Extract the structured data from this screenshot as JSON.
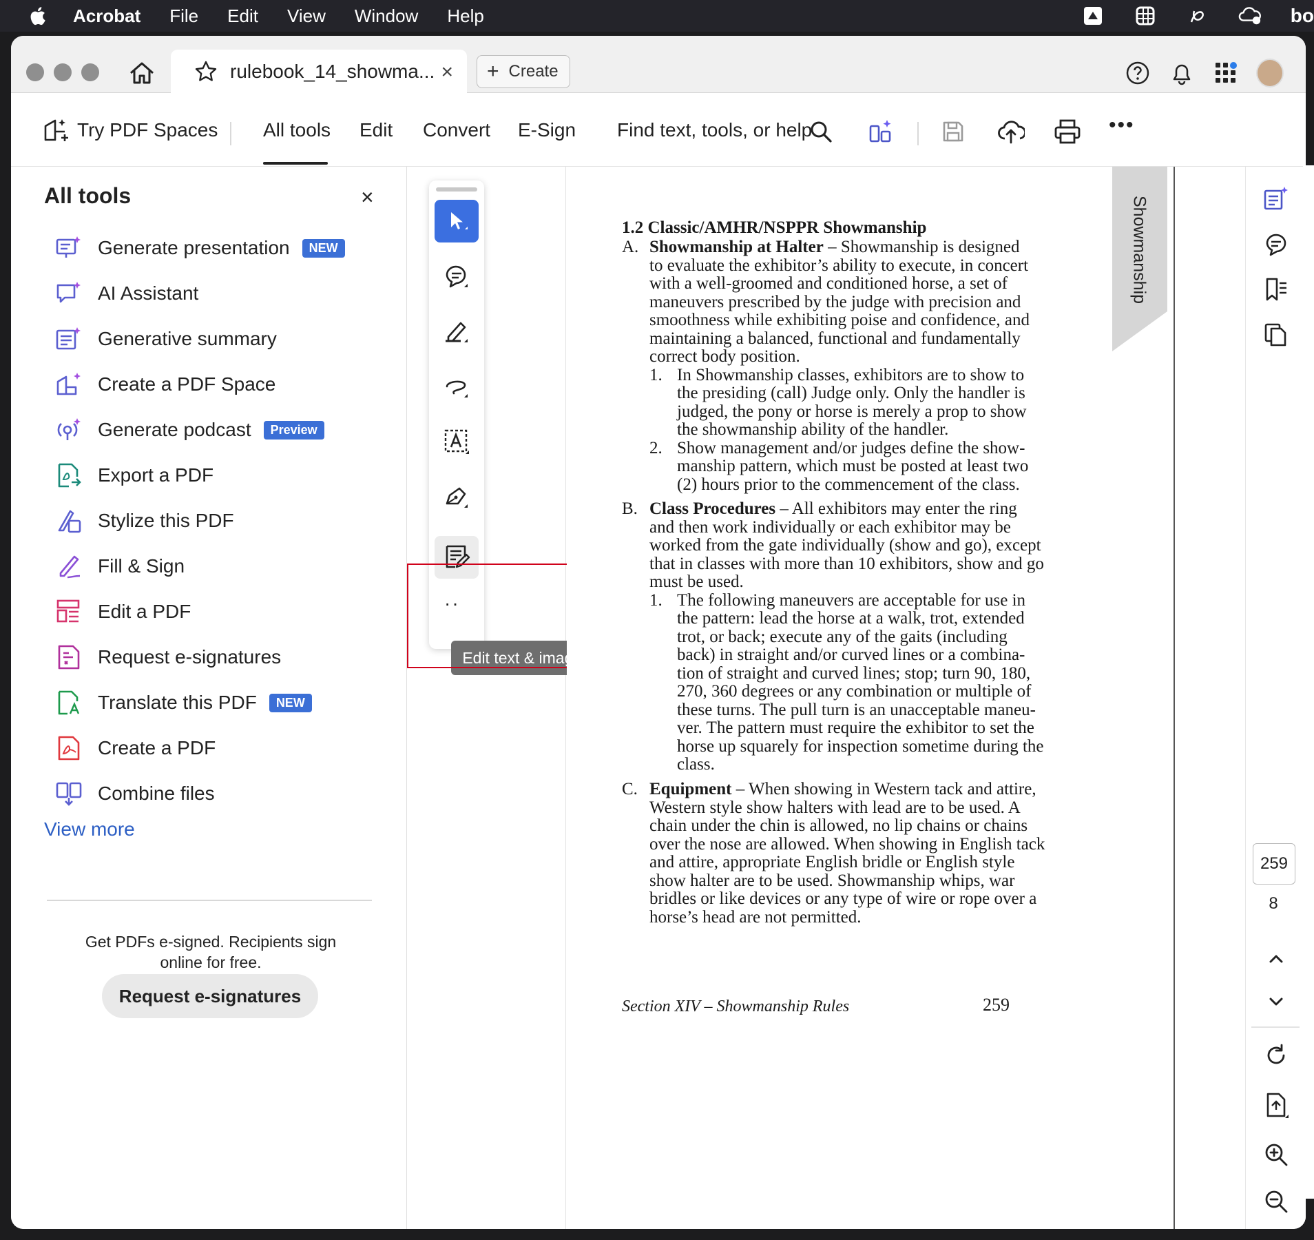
{
  "menubar": {
    "app": "Acrobat",
    "items": [
      "File",
      "Edit",
      "View",
      "Window",
      "Help"
    ],
    "right_text": "bo"
  },
  "tab": {
    "title": "rulebook_14_showma...",
    "close": "×",
    "create_label": "Create"
  },
  "toolbar": {
    "try_spaces": "Try PDF Spaces",
    "all_tools": "All tools",
    "edit": "Edit",
    "convert": "Convert",
    "esign": "E-Sign",
    "search_placeholder": "Find text, tools, or help",
    "more": "•••"
  },
  "left_panel": {
    "title": "All tools",
    "close": "×",
    "tools": [
      {
        "label": "Generate presentation",
        "badge": "NEW",
        "icon": "presentation-sparkle-icon"
      },
      {
        "label": "AI Assistant",
        "badge": "",
        "icon": "ai-chat-icon"
      },
      {
        "label": "Generative summary",
        "badge": "",
        "icon": "summary-sparkle-icon"
      },
      {
        "label": "Create a PDF Space",
        "badge": "",
        "icon": "pdf-space-icon"
      },
      {
        "label": "Generate podcast",
        "badge": "Preview",
        "icon": "podcast-icon"
      },
      {
        "label": "Export a PDF",
        "badge": "",
        "icon": "export-pdf-icon"
      },
      {
        "label": "Stylize this PDF",
        "badge": "",
        "icon": "stylize-icon"
      },
      {
        "label": "Fill & Sign",
        "badge": "",
        "icon": "fill-sign-icon"
      },
      {
        "label": "Edit a PDF",
        "badge": "",
        "icon": "edit-pdf-icon"
      },
      {
        "label": "Request e-signatures",
        "badge": "",
        "icon": "request-signature-icon"
      },
      {
        "label": "Translate this PDF",
        "badge": "NEW",
        "icon": "translate-icon"
      },
      {
        "label": "Create a PDF",
        "badge": "",
        "icon": "create-pdf-icon"
      },
      {
        "label": "Combine files",
        "badge": "",
        "icon": "combine-icon"
      }
    ],
    "view_more": "View more",
    "promo_line1": "Get PDFs e-signed. Recipients sign",
    "promo_line2": "online for free.",
    "promo_button": "Request e-signatures"
  },
  "float_toolbar": {
    "tooltip": "Edit text & images",
    "more": "··"
  },
  "page": {
    "side_tab": "Showmanship",
    "lines": [
      "1.2  Classic/AMHR/NSPPR Showmanship",
      "A.",
      "Showmanship at Halter",
      " – Showmanship is designed",
      "to evaluate the exhibitor’s ability to execute, in concert",
      "with a well-groomed and conditioned horse, a set of",
      "maneuvers prescribed by the judge with precision and",
      "smoothness while exhibiting poise and confidence, and",
      "maintaining a balanced, functional and fundamentally",
      "correct body position.",
      "1.",
      "In Showmanship classes, exhibitors are to show to",
      "the presiding (call) Judge only. Only the handler is",
      "judged, the pony or horse is merely a prop to show",
      "the showmanship ability of the handler.",
      "2.",
      "Show management and/or judges define the show-",
      "manship pattern, which must be posted at least two",
      "(2) hours prior to the commencement of the class.",
      "B.",
      "Class Procedures",
      " – All exhibitors may enter the ring",
      "and then work individually or each exhibitor may be",
      "worked from the gate individually (show and go), except",
      "that in classes with more than 10 exhibitors, show and go",
      "must be used.",
      "1.",
      "The following maneuvers are acceptable for use in",
      "the pattern: lead the horse at a walk, trot, extended",
      "trot, or back; execute any of the gaits (including",
      "back) in straight and/or curved lines or a combina-",
      "tion of straight and curved lines; stop; turn 90, 180,",
      "270, 360 degrees or any combination or multiple of",
      "these turns. The pull turn is an unacceptable maneu-",
      "ver. The pattern must require the exhibitor to set the",
      "horse up squarely for inspection sometime during the",
      "class.",
      "C.",
      "Equipment",
      " – When showing in Western tack and attire,",
      "Western style show halters with lead are to be used. A",
      "chain under the chin is allowed, no lip chains or chains",
      "over the nose are allowed. When showing in English tack",
      "and attire, appropriate English bridle or English style",
      "show halter are to be used. Showmanship whips, war",
      "bridles or like devices or any type of wire or rope over a",
      "horse’s head are not permitted."
    ],
    "footer": "Section XIV – Showmanship Rules",
    "page_number": "259"
  },
  "right_rail": {
    "current_page": "259",
    "total_pages": "8"
  }
}
